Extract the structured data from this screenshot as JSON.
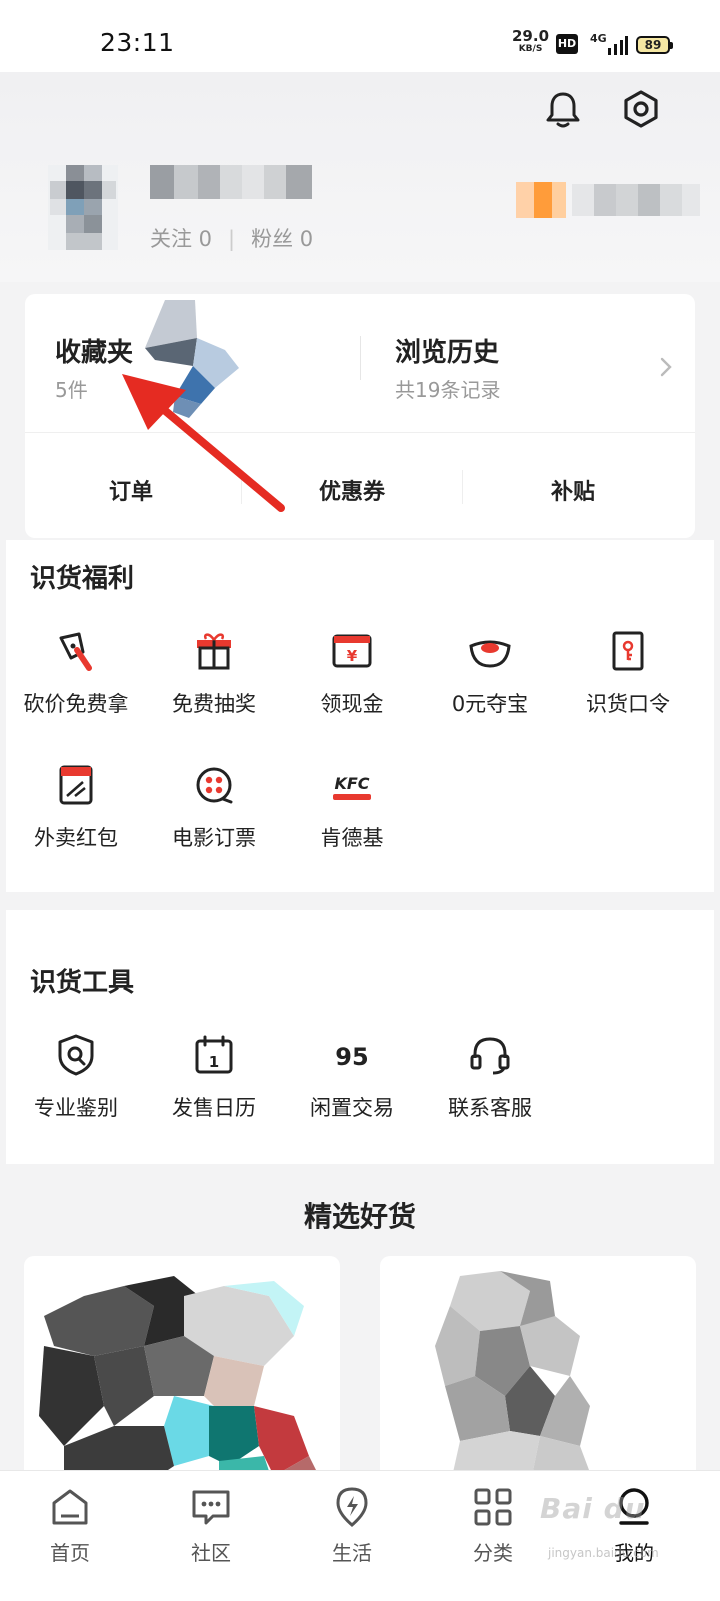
{
  "status_bar": {
    "time": "23:11",
    "speed_value": "29.0",
    "speed_unit": "KB/S",
    "hd": "HD",
    "network": "4G",
    "battery": "89"
  },
  "header": {
    "follow_label": "关注 0",
    "separator": "|",
    "fans_label": "粉丝 0"
  },
  "favorites": {
    "title": "收藏夹",
    "count": "5件"
  },
  "history": {
    "title": "浏览历史",
    "count": "共19条记录"
  },
  "quick_tabs": [
    "订单",
    "优惠券",
    "补贴"
  ],
  "benefits": {
    "title": "识货福利",
    "items": [
      {
        "label": "砍价免费拿",
        "icon": "bargain-axe-icon"
      },
      {
        "label": "免费抽奖",
        "icon": "gift-icon"
      },
      {
        "label": "领现金",
        "icon": "cash-envelope-icon"
      },
      {
        "label": "0元夺宝",
        "icon": "gold-ingot-icon"
      },
      {
        "label": "识货口令",
        "icon": "key-card-icon"
      },
      {
        "label": "外卖红包",
        "icon": "takeout-icon"
      },
      {
        "label": "电影订票",
        "icon": "film-reel-icon"
      },
      {
        "label": "肯德基",
        "icon": "kfc-logo-icon",
        "logo_text": "KFC"
      }
    ]
  },
  "tools": {
    "title": "识货工具",
    "items": [
      {
        "label": "专业鉴别",
        "icon": "authenticate-icon"
      },
      {
        "label": "发售日历",
        "icon": "calendar-icon",
        "badge": "1"
      },
      {
        "label": "闲置交易",
        "icon": "secondhand-95-icon",
        "badge": "95"
      },
      {
        "label": "联系客服",
        "icon": "headset-icon"
      }
    ]
  },
  "picks": {
    "title": "精选好货"
  },
  "tabbar": [
    {
      "label": "首页",
      "icon": "home-icon"
    },
    {
      "label": "社区",
      "icon": "chat-icon"
    },
    {
      "label": "生活",
      "icon": "lightning-icon"
    },
    {
      "label": "分类",
      "icon": "grid-icon"
    },
    {
      "label": "我的",
      "icon": "profile-icon",
      "active": true
    }
  ],
  "watermark": {
    "brand": "Bai du",
    "url": "jingyan.baidu.com"
  },
  "colors": {
    "accent_red": "#e8392f",
    "background": "#f3f3f4",
    "text": "#222222",
    "muted": "#999999"
  }
}
